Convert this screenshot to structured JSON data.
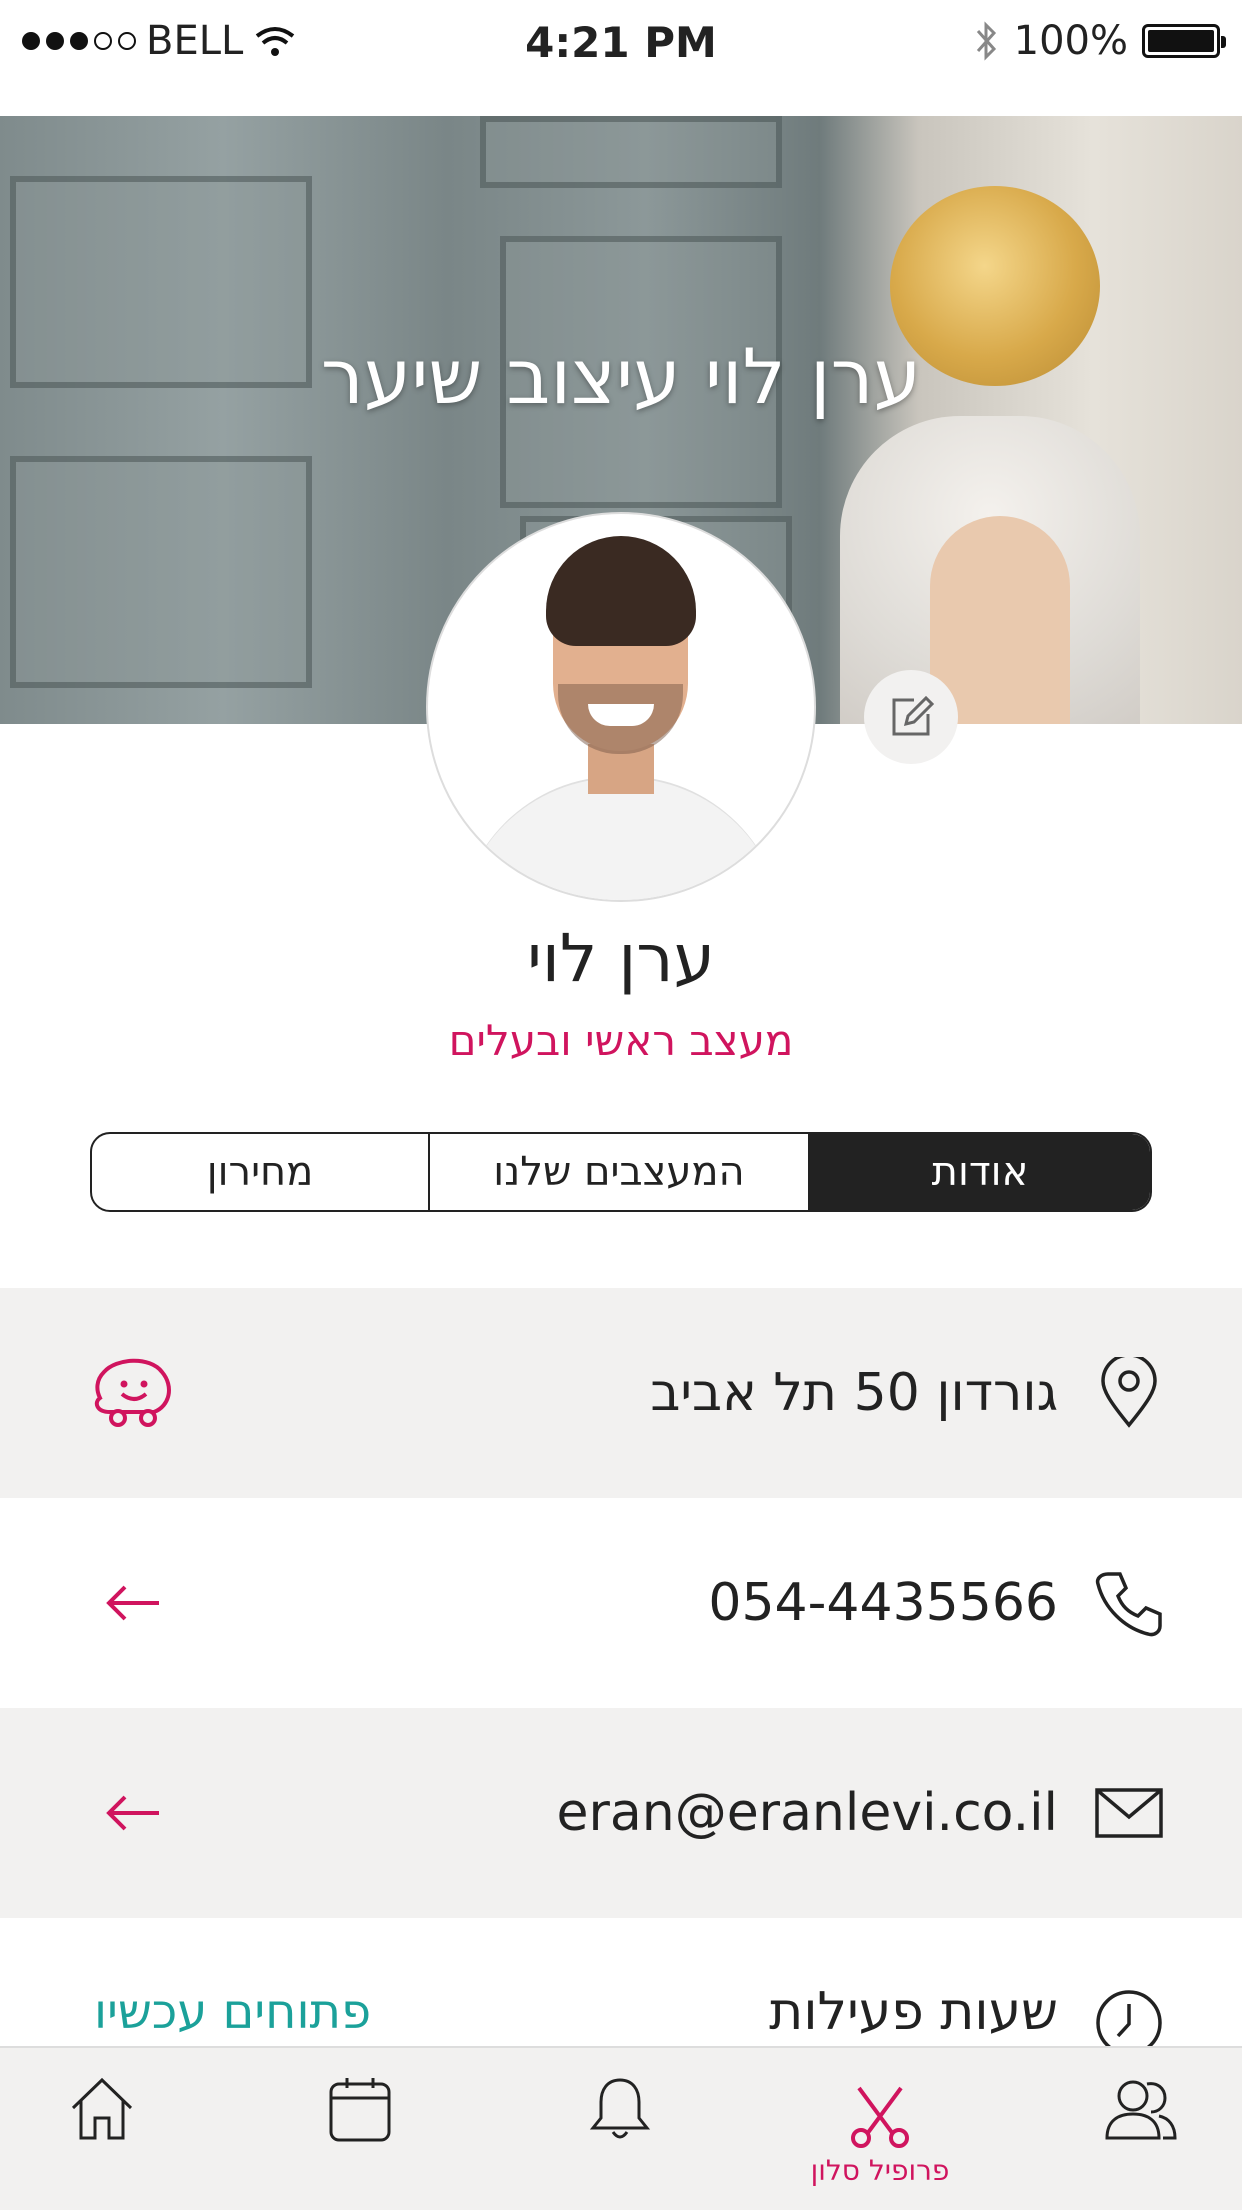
{
  "status_bar": {
    "carrier": "BELL",
    "time": "4:21 PM",
    "battery": "100%"
  },
  "cover": {
    "title": "ערן לוי עיצוב שיער"
  },
  "profile": {
    "name": "ערן לוי",
    "role": "מעצב ראשי ובעלים"
  },
  "tabs": [
    {
      "label": "אודות",
      "active": true
    },
    {
      "label": "המעצבים שלנו",
      "active": false
    },
    {
      "label": "מחירון",
      "active": false
    }
  ],
  "info": {
    "address": "גורדון 50 תל אביב",
    "phone": "054-4435566",
    "email": "eran@eranlevi.co.il",
    "hours_label": "שעות פעילות",
    "open_now": "פתוחים עכשיו"
  },
  "bottom_nav": {
    "active_label": "פרופיל סלון"
  },
  "colors": {
    "accent": "#d0145e",
    "teal": "#1ba19a",
    "dark": "#222222",
    "shade": "#f2f1f0"
  }
}
